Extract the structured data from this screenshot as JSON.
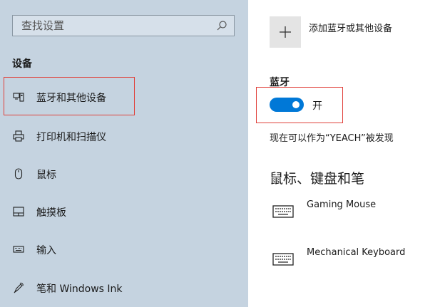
{
  "search": {
    "placeholder": "查找设置",
    "icon": "search-icon"
  },
  "sidebar": {
    "section_title": "设备",
    "items": [
      {
        "label": "蓝牙和其他设备",
        "icon": "bluetooth-device-icon"
      },
      {
        "label": "打印机和扫描仪",
        "icon": "printer-icon"
      },
      {
        "label": "鼠标",
        "icon": "mouse-icon"
      },
      {
        "label": "触摸板",
        "icon": "touchpad-icon"
      },
      {
        "label": "输入",
        "icon": "keyboard-icon"
      },
      {
        "label": "笔和 Windows Ink",
        "icon": "pen-icon"
      }
    ]
  },
  "main": {
    "add_device_label": "添加蓝牙或其他设备",
    "bluetooth_heading": "蓝牙",
    "bluetooth_toggle": {
      "label": "开",
      "on": true
    },
    "discoverable_text": "现在可以作为“YEACH”被发现",
    "devices_heading": "鼠标、键盘和笔",
    "devices": [
      {
        "name": "Gaming Mouse",
        "icon": "keyboard-icon"
      },
      {
        "name": "Mechanical Keyboard",
        "icon": "keyboard-icon"
      }
    ]
  },
  "colors": {
    "sidebar_bg": "#c5d3e0",
    "accent": "#0078d7",
    "highlight_border": "#e0403a"
  }
}
